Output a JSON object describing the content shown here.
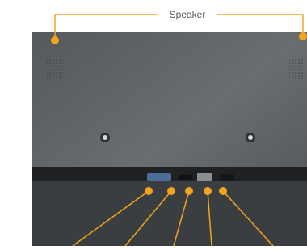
{
  "speaker_label": "Speaker",
  "colors": {
    "accent": "#f2a61d",
    "panel_back": "#5e6163",
    "tray": "#3a3d40"
  },
  "callouts": [
    {
      "name": "speaker-left-dot"
    },
    {
      "name": "speaker-right-dot"
    },
    {
      "name": "port-1-dot"
    },
    {
      "name": "port-2-dot"
    },
    {
      "name": "port-3-dot"
    },
    {
      "name": "port-4-dot"
    },
    {
      "name": "port-5-dot"
    }
  ]
}
